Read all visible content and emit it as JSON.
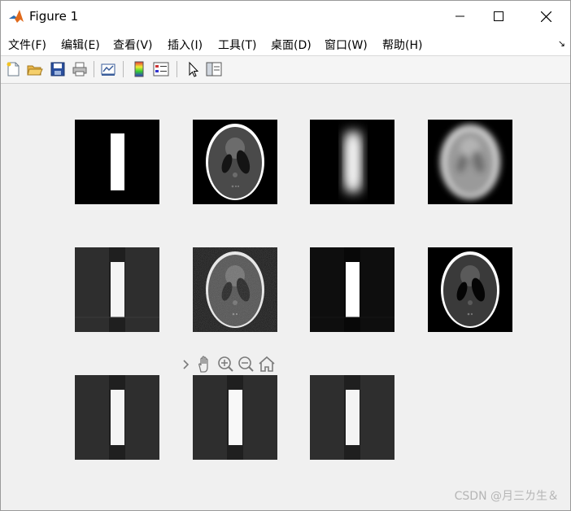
{
  "window": {
    "title": "Figure 1"
  },
  "menu": [
    {
      "label": "文件(F)"
    },
    {
      "label": "编辑(E)"
    },
    {
      "label": "查看(V)"
    },
    {
      "label": "插入(I)"
    },
    {
      "label": "工具(T)"
    },
    {
      "label": "桌面(D)"
    },
    {
      "label": "窗口(W)"
    },
    {
      "label": "帮助(H)"
    }
  ],
  "toolbar": [
    "new-figure",
    "open-file",
    "save",
    "print",
    "link-plot",
    "insert-colorbar",
    "insert-legend",
    "edit-plot",
    "show-plot-tools"
  ],
  "axes_toolbar": [
    "expand",
    "pan",
    "zoom-in",
    "zoom-out",
    "restore-view"
  ],
  "panels": [
    "rectangle",
    "phantom",
    "blurred-rectangle",
    "blurred-phantom",
    "restored-rectangle",
    "noisy-phantom",
    "rectangle-dark",
    "restored-phantom",
    "restored-rectangle-2",
    "restored-rectangle-3",
    "restored-rectangle-4"
  ],
  "watermark": "CSDN @月三ㄌ生＆"
}
